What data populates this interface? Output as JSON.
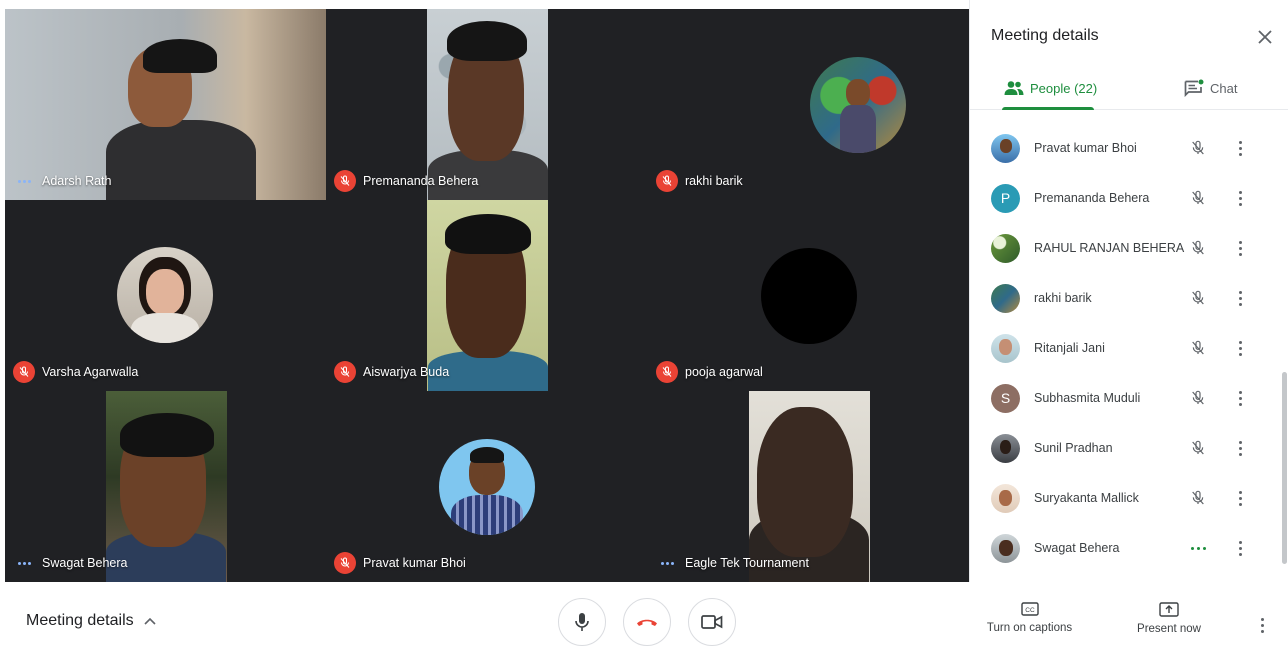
{
  "grid": {
    "tiles": [
      {
        "name": "Adarsh Rath",
        "status": "speaking"
      },
      {
        "name": "Premananda Behera",
        "status": "muted"
      },
      {
        "name": "rakhi barik",
        "status": "muted"
      },
      {
        "name": "Varsha Agarwalla",
        "status": "muted"
      },
      {
        "name": "Aiswarjya Buda",
        "status": "muted"
      },
      {
        "name": "pooja agarwal",
        "status": "muted"
      },
      {
        "name": "Swagat Behera",
        "status": "speaking"
      },
      {
        "name": "Pravat kumar Bhoi",
        "status": "muted"
      },
      {
        "name": "Eagle Tek Tournament",
        "status": "speaking"
      }
    ]
  },
  "panel": {
    "title": "Meeting details",
    "tabs": {
      "people": "People (22)",
      "chat": "Chat"
    },
    "people": [
      {
        "name": "Pravat kumar Bhoi",
        "avatar": "photo",
        "status": "muted"
      },
      {
        "name": "Premananda Behera",
        "avatar": "P",
        "avatar_color": "#2a9bb5",
        "status": "muted"
      },
      {
        "name": "RAHUL RANJAN BEHERA",
        "avatar": "photo",
        "status": "muted"
      },
      {
        "name": "rakhi barik",
        "avatar": "photo",
        "status": "muted"
      },
      {
        "name": "Ritanjali Jani",
        "avatar": "photo",
        "status": "muted"
      },
      {
        "name": "Subhasmita Muduli",
        "avatar": "S",
        "avatar_color": "#8d6e63",
        "status": "muted"
      },
      {
        "name": "Sunil Pradhan",
        "avatar": "photo",
        "status": "muted"
      },
      {
        "name": "Suryakanta Mallick",
        "avatar": "photo",
        "status": "muted"
      },
      {
        "name": "Swagat Behera",
        "avatar": "photo",
        "status": "speaking"
      }
    ]
  },
  "bottom_bar": {
    "meeting_details": "Meeting details",
    "captions": "Turn on captions",
    "present": "Present now"
  },
  "colors": {
    "accent": "#1e8e3e",
    "mute_red": "#ea4335",
    "grid_bg": "#202124"
  }
}
